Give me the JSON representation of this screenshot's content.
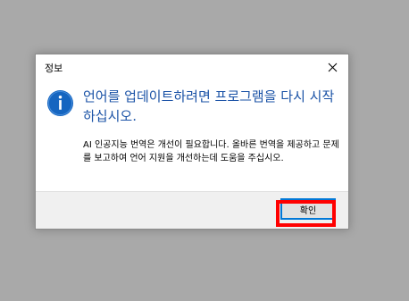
{
  "dialog": {
    "title": "정보",
    "close_icon": "close-icon",
    "info_icon": "info-icon",
    "main_instruction": "언어를 업데이트하려면 프로그램을 다시 시작하십시오.",
    "content": "AI 인공지능 번역은 개선이 필요합니다. 올바른 번역을 제공하고 문제를 보고하여 언어 지원을 개선하는데 도움을 주십시오.",
    "ok_label": "확인"
  },
  "colors": {
    "instruction_blue": "#1a52a6",
    "icon_blue": "#1565c0",
    "highlight_red": "#ff0000",
    "backdrop": "#a9a9a9"
  }
}
